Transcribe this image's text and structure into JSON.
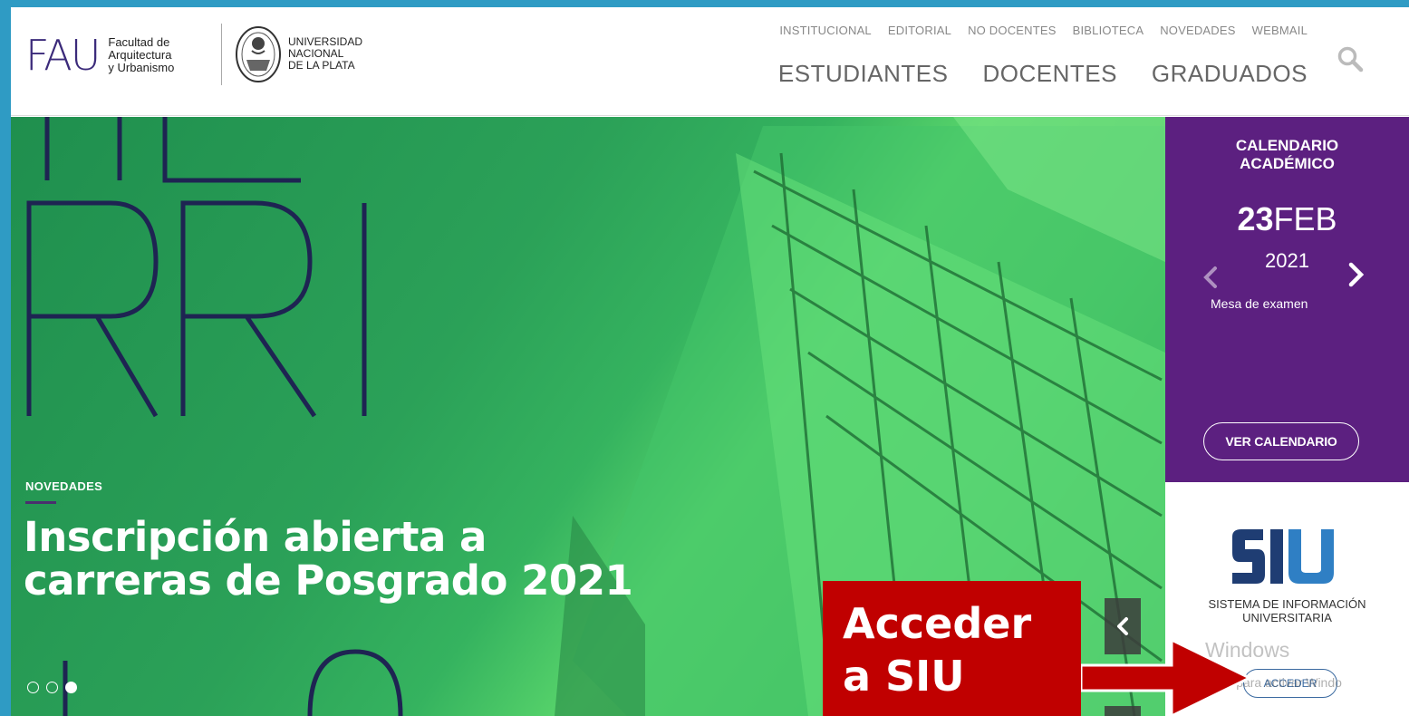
{
  "header": {
    "fau_letters": "FAU",
    "fau_name_line1": "Facultad de",
    "fau_name_line2": "Arquitectura",
    "fau_name_line3": "y Urbanismo",
    "unlp_line1": "UNIVERSIDAD",
    "unlp_line2": "NACIONAL",
    "unlp_line3": "DE LA PLATA",
    "top_links": [
      "INSTITUCIONAL",
      "EDITORIAL",
      "NO DOCENTES",
      "BIBLIOTECA",
      "NOVEDADES",
      "WEBMAIL"
    ],
    "main_links": [
      "ESTUDIANTES",
      "DOCENTES",
      "GRADUADOS"
    ]
  },
  "hero": {
    "eyebrow": "NOVEDADES",
    "title_line1": "Inscripción abierta a",
    "title_line2": "carreras de Posgrado 2021",
    "slides_total": 3,
    "active_slide": 3
  },
  "calendar": {
    "title_line1": "CALENDARIO",
    "title_line2": "ACADÉMICO",
    "day": "23",
    "month": "FEB",
    "year": "2021",
    "event": "Mesa de examen",
    "button": "VER CALENDARIO"
  },
  "siu": {
    "logo_text": "SIU",
    "name_line1": "SISTEMA DE INFORMACIÓN",
    "name_line2": "UNIVERSITARIA",
    "button": "ACCEDER"
  },
  "watermark": {
    "line1": "Windows",
    "line2": "Ve a Configuración para activar Windo"
  },
  "annotation": {
    "line1": "Acceder",
    "line2": "a SIU"
  },
  "colors": {
    "frame": "#2f9bc4",
    "purple": "#5c2080",
    "annotation_red": "#c00000",
    "hero_green": "#35b35f"
  }
}
